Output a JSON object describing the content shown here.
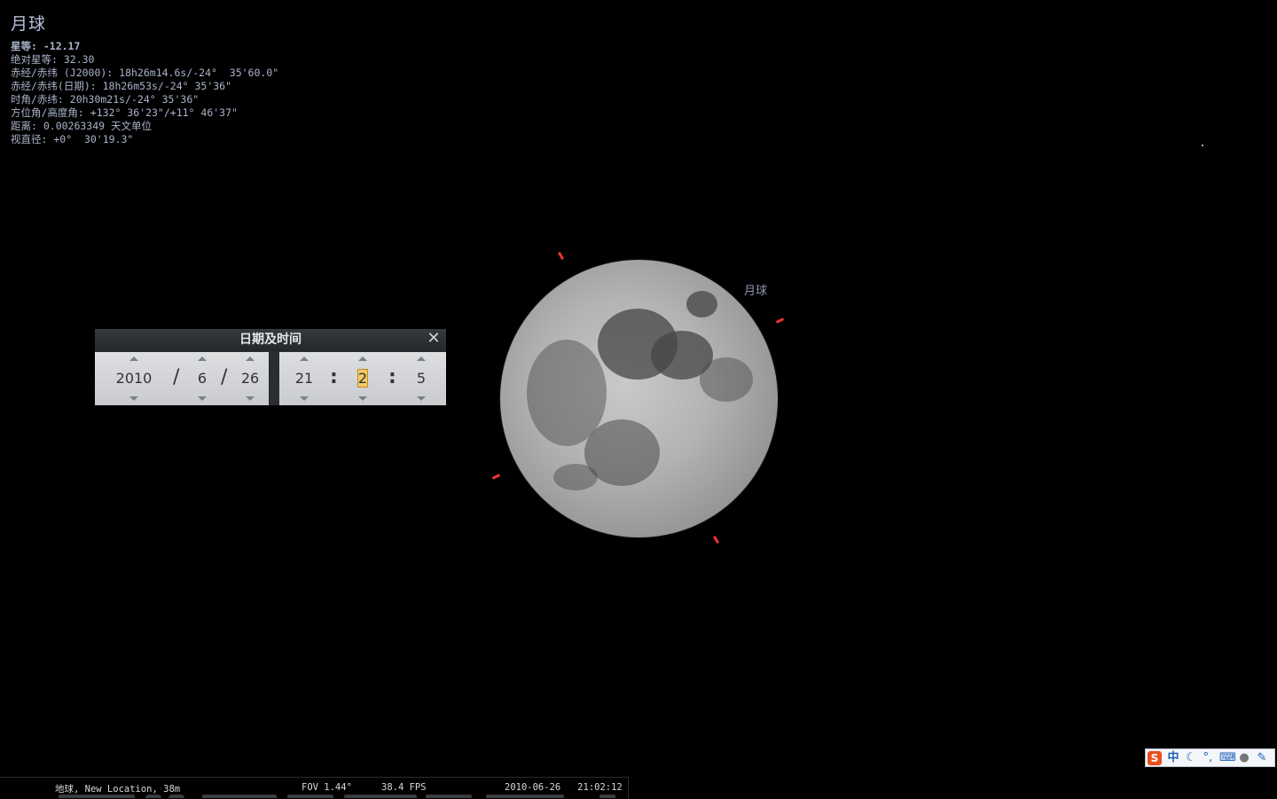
{
  "object": {
    "name": "月球",
    "lines": [
      "星等: -12.17",
      "绝对星等: 32.30",
      "赤经/赤纬 (J2000): 18h26m14.6s/-24°  35'60.0\"",
      "赤经/赤纬(日期): 18h26m53s/-24° 35'36\"",
      "时角/赤纬: 20h30m21s/-24° 35'36\"",
      "方位角/高度角: +132° 36'23\"/+11° 46'37\"",
      "距离: 0.00263349 天文单位",
      "视直径: +0°  30'19.3\""
    ],
    "label": "月球"
  },
  "dialog": {
    "title": "日期及时间",
    "close_icon": "close-icon",
    "date": {
      "year": "2010",
      "month": "6",
      "day": "26",
      "sep": "/"
    },
    "time": {
      "hour": "21",
      "minute": "2",
      "second": "5",
      "sep": ":"
    }
  },
  "statusbar": {
    "location": "地球, New Location, 38m",
    "fov": "FOV 1.44°",
    "fps": "38.4 FPS",
    "datetime": "2010-06-26   21:02:12"
  },
  "ime": {
    "icons": [
      "sogou-logo-icon",
      "chinese-mode-icon",
      "moon-icon",
      "punctuation-icon",
      "keyboard-icon",
      "user-icon",
      "wrench-icon"
    ],
    "chinese_label": "中"
  },
  "colors": {
    "sky": "#000000",
    "info_text": "#a9b3c9",
    "marker": "#e33333",
    "selection": "#f2c96b"
  }
}
